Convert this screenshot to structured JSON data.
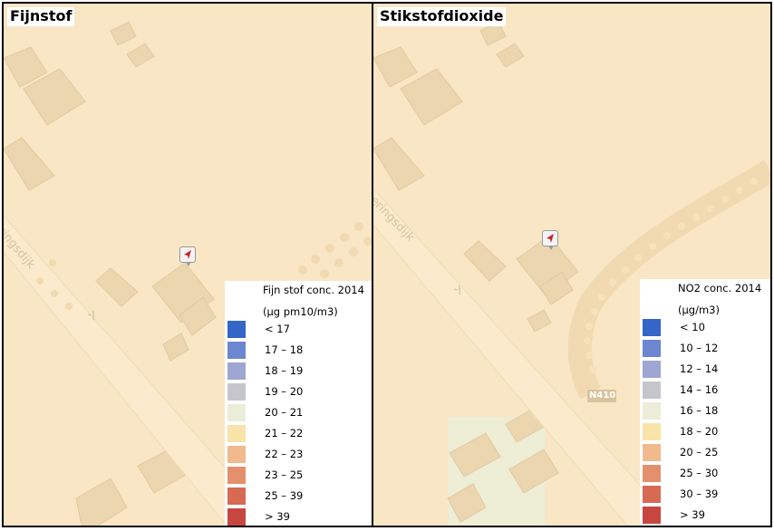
{
  "panels": [
    {
      "title": "Fijnstof",
      "road_label": "ringsdijk",
      "legend": {
        "title_line1": "Fijn stof conc. 2014",
        "title_line2": "(µg pm10/m3)",
        "items": [
          {
            "label": "< 17",
            "color": "#3465c8"
          },
          {
            "label": "17 – 18",
            "color": "#6c86cf"
          },
          {
            "label": "18 – 19",
            "color": "#9ea6d2"
          },
          {
            "label": "19 – 20",
            "color": "#c4c6cc"
          },
          {
            "label": "20 – 21",
            "color": "#ecedd8"
          },
          {
            "label": "21 – 22",
            "color": "#f8e4a8"
          },
          {
            "label": "22 – 23",
            "color": "#f0ba8c"
          },
          {
            "label": "23 – 25",
            "color": "#e4906c"
          },
          {
            "label": "25 – 39",
            "color": "#d66a52"
          },
          {
            "label": "> 39",
            "color": "#c84640"
          }
        ]
      }
    },
    {
      "title": "Stikstofdioxide",
      "road_label": "eringsdijk",
      "road_shield": "N410",
      "legend": {
        "title_line1": "NO2 conc. 2014",
        "title_line2": "(µg/m3)",
        "items": [
          {
            "label": "< 10",
            "color": "#3465c8"
          },
          {
            "label": "10 – 12",
            "color": "#6c86cf"
          },
          {
            "label": "12 – 14",
            "color": "#9ea6d2"
          },
          {
            "label": "14 – 16",
            "color": "#c4c6cc"
          },
          {
            "label": "16 – 18",
            "color": "#ecedd8"
          },
          {
            "label": "18 – 20",
            "color": "#f8e4a8"
          },
          {
            "label": "20 – 25",
            "color": "#f0ba8c"
          },
          {
            "label": "25 – 30",
            "color": "#e4906c"
          },
          {
            "label": "30 – 39",
            "color": "#d66a52"
          },
          {
            "label": "> 39",
            "color": "#c84640"
          }
        ]
      }
    }
  ]
}
